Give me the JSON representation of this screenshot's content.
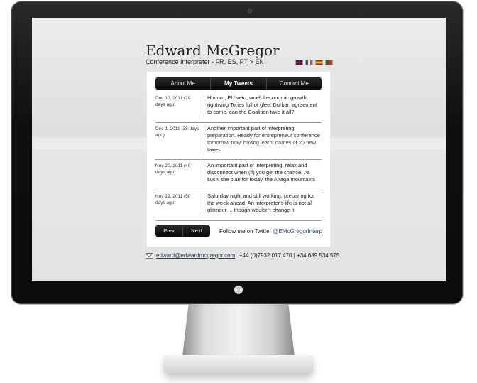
{
  "site": {
    "title": "Edward McGregor",
    "subtitle_prefix": "Conference Interpreter - ",
    "langs": [
      "FR",
      "ES",
      "PT"
    ],
    "subtitle_sep1": ", ",
    "subtitle_sep2": ", ",
    "subtitle_arrow": " > ",
    "target_lang": "EN",
    "flags": [
      "flag-gb-icon",
      "flag-fr-icon",
      "flag-es-icon",
      "flag-pt-icon"
    ]
  },
  "nav": {
    "tabs": [
      {
        "label": "About Me",
        "active": false
      },
      {
        "label": "My Tweets",
        "active": true
      },
      {
        "label": "Contact Me",
        "active": false
      }
    ]
  },
  "tweets": [
    {
      "date": "Dec 10, 2011 (29 days ago)",
      "text": "Hmmm, EU veto, woeful economic growth, rightwing Tories full of glee, Durban agreement to come, can the Coalition take it all?"
    },
    {
      "date": "Dec 1, 2011 (38 days ago)",
      "text": "Another important part of interpreting: preparation. Ready for entrepreneur conference tomorrow now, having learnt names of 20 new taxes"
    },
    {
      "date": "Nov 20, 2011 (49 days ago)",
      "text": "An important part of interpreting, relax and disconnect when (if) you get the chance. As such, the plan for today, the Anaga mountains"
    },
    {
      "date": "Nov 19, 2011 (50 days ago)",
      "text": "Saturday night and still working, preparing for the week ahead. An interpreter's life is not all glamour ... though wouldn't change it"
    }
  ],
  "pager": {
    "prev": "Prev",
    "next": "Next"
  },
  "follow": {
    "label": "Follow me on Twitter ",
    "handle": "@EMcGregorInterp"
  },
  "footer": {
    "email": "edward@edwardmcgregor.com",
    "phone": "+44 (0)7932 017 470 | +34 689 534 575"
  },
  "colors": {
    "bezel": "#0f0f0f",
    "nav_bar": "#111111",
    "link": "#2a4a8a"
  }
}
